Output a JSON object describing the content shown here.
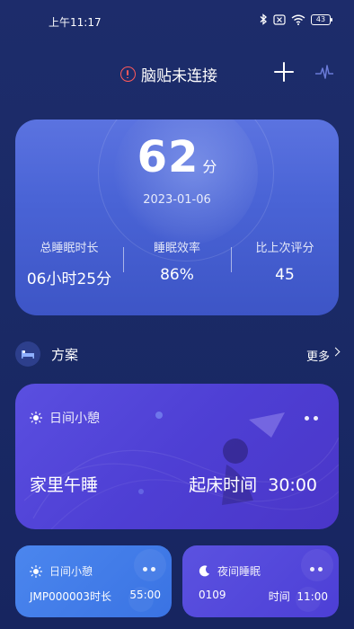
{
  "status_bar": {
    "time": "上午11:17",
    "battery": "43",
    "icons": [
      "bluetooth-icon",
      "sim-x-icon",
      "wifi-icon",
      "battery-icon"
    ]
  },
  "header": {
    "connection_status": "脑贴未连接",
    "alert_color": "#ff5a5a",
    "icons": [
      "alert-circle-icon",
      "plus-icon",
      "heartbeat-wave-icon"
    ]
  },
  "score_card": {
    "score": "62",
    "score_unit": "分",
    "date": "2023-01-06",
    "stats": [
      {
        "label": "总睡眠时长",
        "value": "06小时25分"
      },
      {
        "label": "睡眠效率",
        "value": "86%"
      },
      {
        "label": "比上次评分",
        "value": "45"
      }
    ]
  },
  "plans_section": {
    "title": "方案",
    "more_label": "更多"
  },
  "plan_cards": {
    "main": {
      "type_label": "日间小憩",
      "name": "家里午睡",
      "wake_label": "起床时间",
      "wake_value": "30:00"
    },
    "day": {
      "type_label": "日间小憩",
      "code": "JMP000003时长",
      "duration": "55:00"
    },
    "night": {
      "type_label": "夜间睡眠",
      "code": "0109",
      "time_label": "时间",
      "time_value": "11:00"
    }
  }
}
